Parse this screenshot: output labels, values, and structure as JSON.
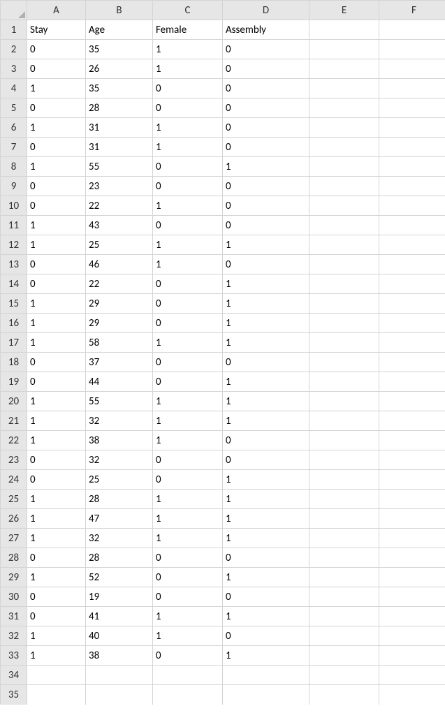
{
  "columns": [
    "A",
    "B",
    "C",
    "D",
    "E",
    "F"
  ],
  "rowNumbers": [
    "1",
    "2",
    "3",
    "4",
    "5",
    "6",
    "7",
    "8",
    "9",
    "10",
    "11",
    "12",
    "13",
    "14",
    "15",
    "16",
    "17",
    "18",
    "19",
    "20",
    "21",
    "22",
    "23",
    "24",
    "25",
    "26",
    "27",
    "28",
    "29",
    "30",
    "31",
    "32",
    "33",
    "34",
    "35"
  ],
  "headerRow": {
    "A": "Stay",
    "B": "Age",
    "C": "Female",
    "D": "Assembly",
    "E": "",
    "F": ""
  },
  "dataRows": [
    {
      "A": "0",
      "B": "35",
      "C": "1",
      "D": "0",
      "E": "",
      "F": ""
    },
    {
      "A": "0",
      "B": "26",
      "C": "1",
      "D": "0",
      "E": "",
      "F": ""
    },
    {
      "A": "1",
      "B": "35",
      "C": "0",
      "D": "0",
      "E": "",
      "F": ""
    },
    {
      "A": "0",
      "B": "28",
      "C": "0",
      "D": "0",
      "E": "",
      "F": ""
    },
    {
      "A": "1",
      "B": "31",
      "C": "1",
      "D": "0",
      "E": "",
      "F": ""
    },
    {
      "A": "0",
      "B": "31",
      "C": "1",
      "D": "0",
      "E": "",
      "F": ""
    },
    {
      "A": "1",
      "B": "55",
      "C": "0",
      "D": "1",
      "E": "",
      "F": ""
    },
    {
      "A": "0",
      "B": "23",
      "C": "0",
      "D": "0",
      "E": "",
      "F": ""
    },
    {
      "A": "0",
      "B": "22",
      "C": "1",
      "D": "0",
      "E": "",
      "F": ""
    },
    {
      "A": "1",
      "B": "43",
      "C": "0",
      "D": "0",
      "E": "",
      "F": ""
    },
    {
      "A": "1",
      "B": "25",
      "C": "1",
      "D": "1",
      "E": "",
      "F": ""
    },
    {
      "A": "0",
      "B": "46",
      "C": "1",
      "D": "0",
      "E": "",
      "F": ""
    },
    {
      "A": "0",
      "B": "22",
      "C": "0",
      "D": "1",
      "E": "",
      "F": ""
    },
    {
      "A": "1",
      "B": "29",
      "C": "0",
      "D": "1",
      "E": "",
      "F": ""
    },
    {
      "A": "1",
      "B": "29",
      "C": "0",
      "D": "1",
      "E": "",
      "F": ""
    },
    {
      "A": "1",
      "B": "58",
      "C": "1",
      "D": "1",
      "E": "",
      "F": ""
    },
    {
      "A": "0",
      "B": "37",
      "C": "0",
      "D": "0",
      "E": "",
      "F": ""
    },
    {
      "A": "0",
      "B": "44",
      "C": "0",
      "D": "1",
      "E": "",
      "F": ""
    },
    {
      "A": "1",
      "B": "55",
      "C": "1",
      "D": "1",
      "E": "",
      "F": ""
    },
    {
      "A": "1",
      "B": "32",
      "C": "1",
      "D": "1",
      "E": "",
      "F": ""
    },
    {
      "A": "1",
      "B": "38",
      "C": "1",
      "D": "0",
      "E": "",
      "F": ""
    },
    {
      "A": "0",
      "B": "32",
      "C": "0",
      "D": "0",
      "E": "",
      "F": ""
    },
    {
      "A": "0",
      "B": "25",
      "C": "0",
      "D": "1",
      "E": "",
      "F": ""
    },
    {
      "A": "1",
      "B": "28",
      "C": "1",
      "D": "1",
      "E": "",
      "F": ""
    },
    {
      "A": "1",
      "B": "47",
      "C": "1",
      "D": "1",
      "E": "",
      "F": ""
    },
    {
      "A": "1",
      "B": "32",
      "C": "1",
      "D": "1",
      "E": "",
      "F": ""
    },
    {
      "A": "0",
      "B": "28",
      "C": "0",
      "D": "0",
      "E": "",
      "F": ""
    },
    {
      "A": "1",
      "B": "52",
      "C": "0",
      "D": "1",
      "E": "",
      "F": ""
    },
    {
      "A": "0",
      "B": "19",
      "C": "0",
      "D": "0",
      "E": "",
      "F": ""
    },
    {
      "A": "0",
      "B": "41",
      "C": "1",
      "D": "1",
      "E": "",
      "F": ""
    },
    {
      "A": "1",
      "B": "40",
      "C": "1",
      "D": "0",
      "E": "",
      "F": ""
    },
    {
      "A": "1",
      "B": "38",
      "C": "0",
      "D": "1",
      "E": "",
      "F": ""
    },
    {
      "A": "",
      "B": "",
      "C": "",
      "D": "",
      "E": "",
      "F": ""
    },
    {
      "A": "",
      "B": "",
      "C": "",
      "D": "",
      "E": "",
      "F": ""
    }
  ]
}
